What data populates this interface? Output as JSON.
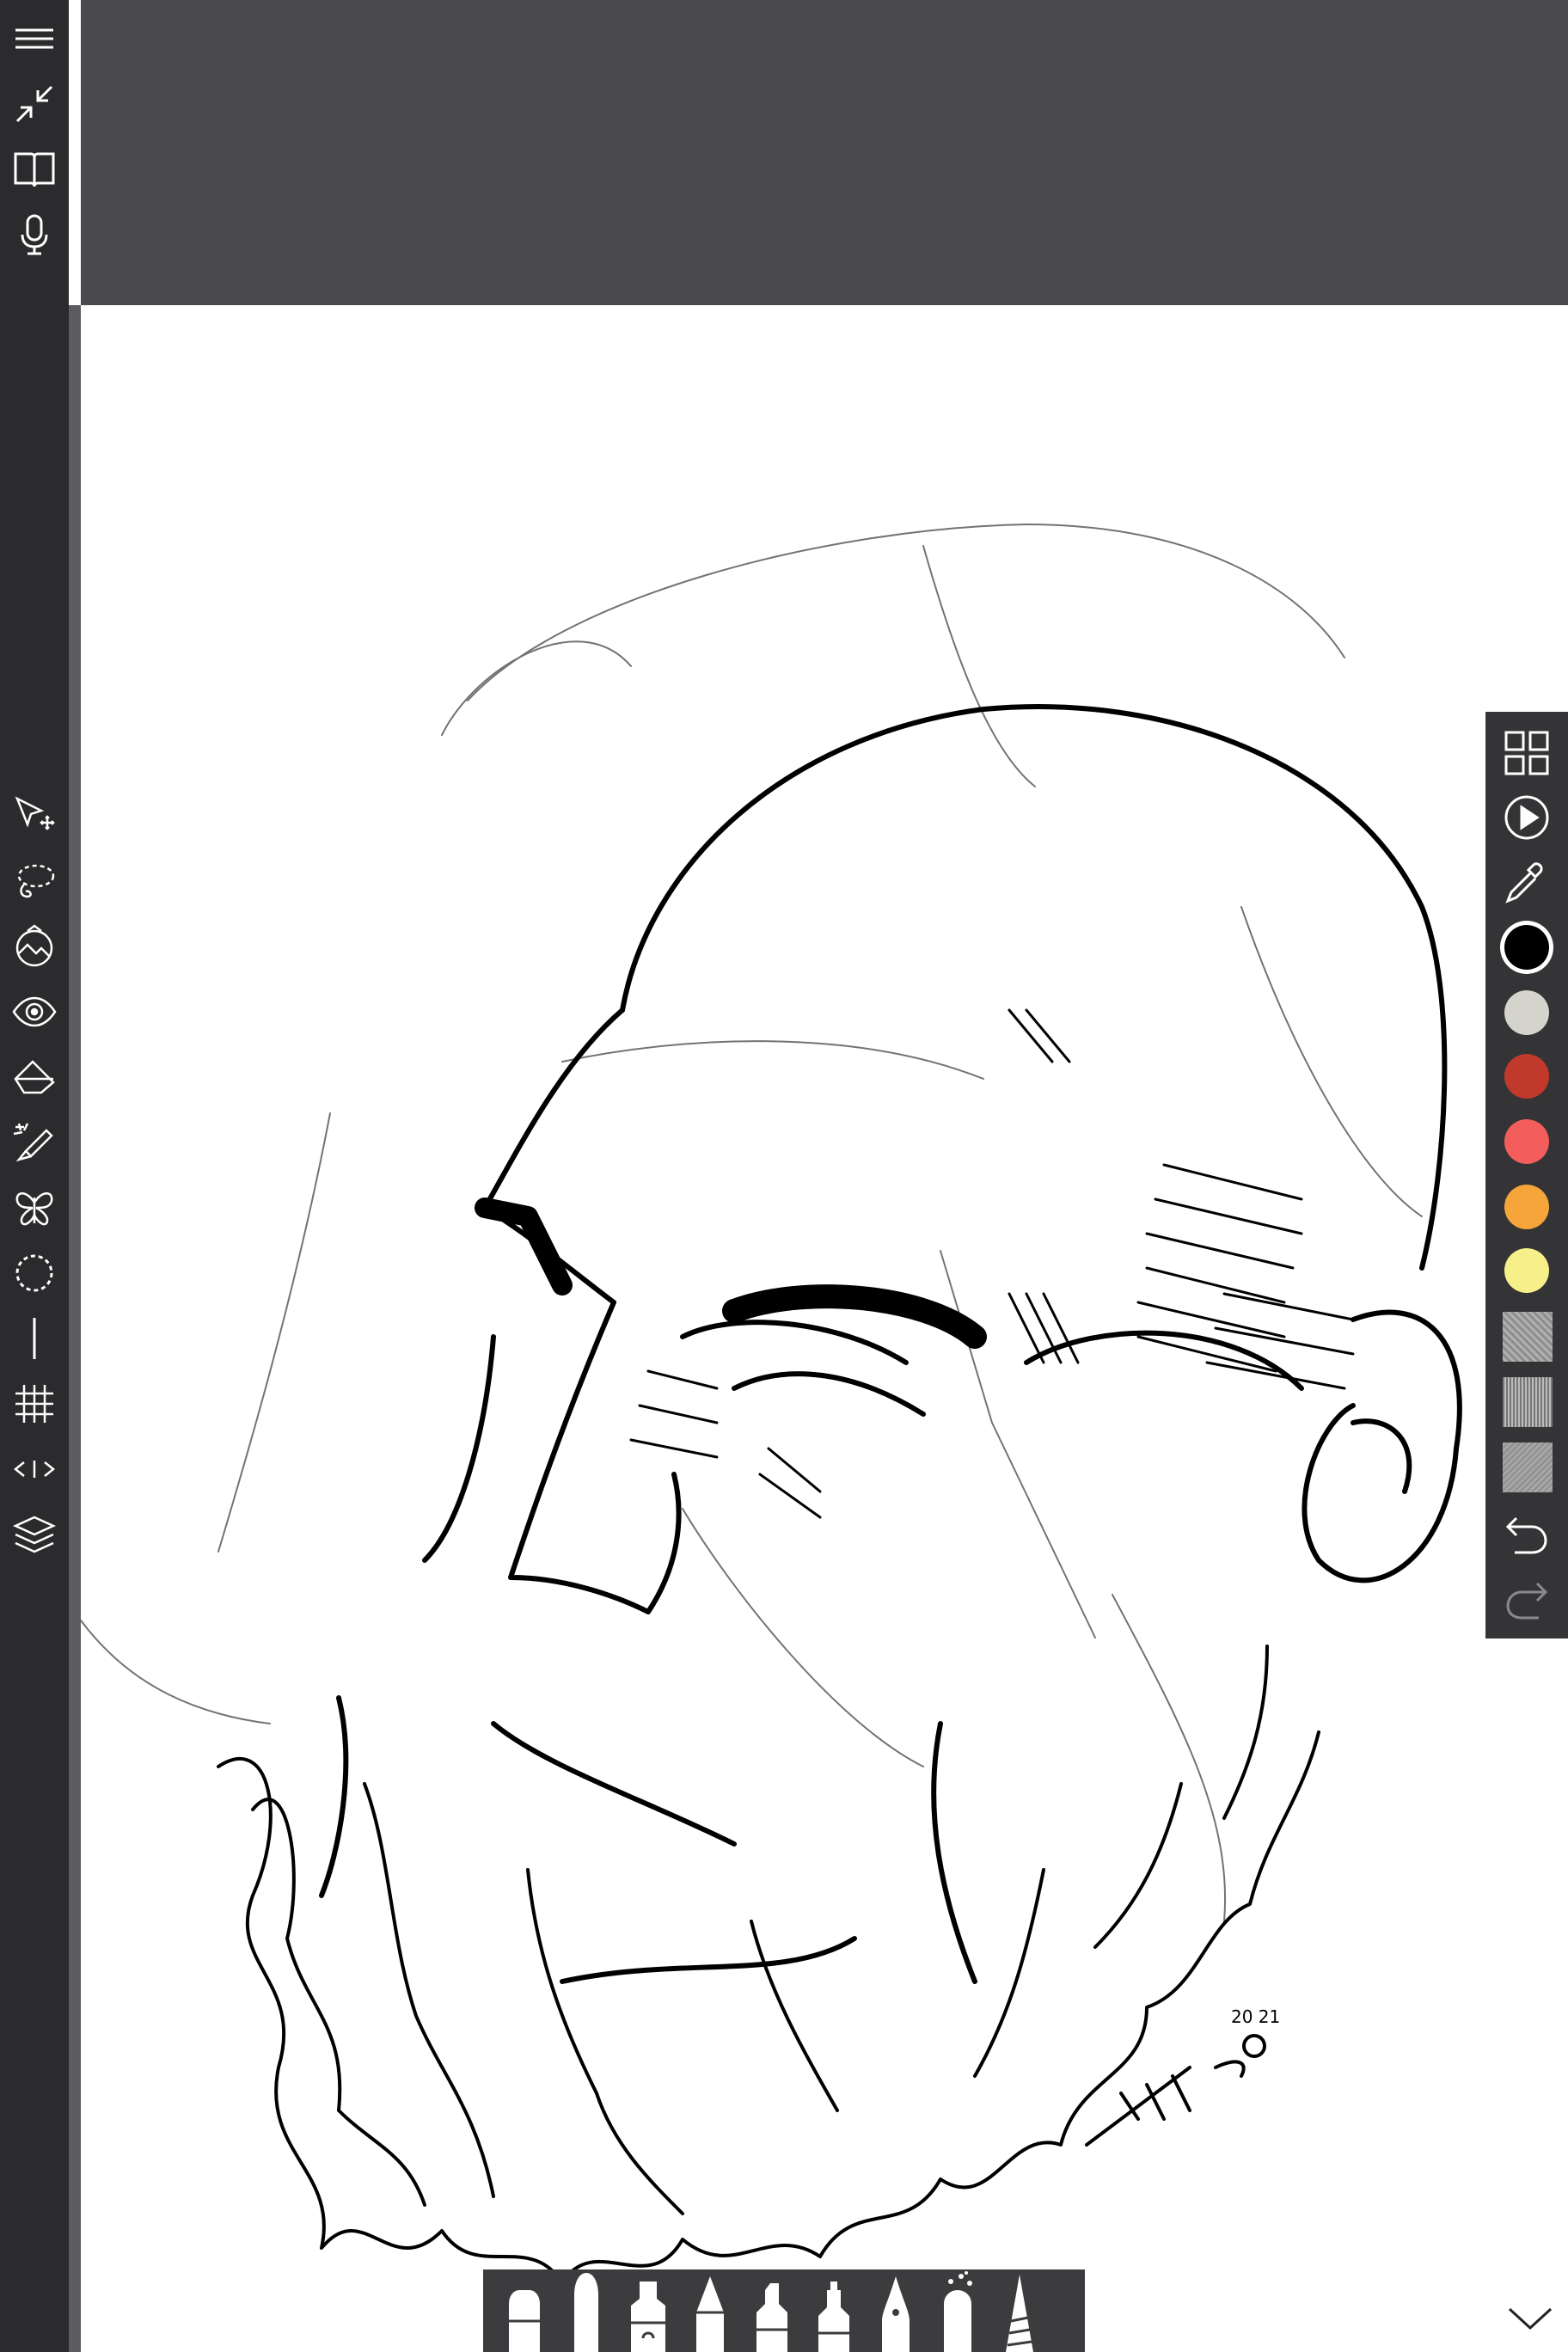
{
  "app": {
    "colors": {
      "toolbar_bg": "#2b2b2d",
      "top_area_bg": "#4a4a4c",
      "canvas_bg": "#ffffff",
      "palette_bg": "#343436",
      "icon_color": "#ffffff"
    }
  },
  "left_toolbar": {
    "top_tools": [
      "menu-icon",
      "minimize-icon",
      "book-icon",
      "microphone-icon"
    ],
    "drawing_tools": [
      "transform-select-icon",
      "lasso-icon",
      "image-adjust-icon",
      "visibility-eye-icon",
      "fill-bucket-icon",
      "magic-brush-icon",
      "symmetry-butterfly-icon",
      "circle-guide-icon",
      "line-guide-icon",
      "grid-guide-icon",
      "perspective-guide-icon",
      "layers-icon"
    ]
  },
  "right_palette": {
    "tools": [
      "grid-view-icon",
      "play-icon",
      "eyedropper-icon"
    ],
    "swatches": [
      {
        "color": "#000000",
        "selected": true
      },
      {
        "color": "#d4d4cc",
        "selected": false
      },
      {
        "color": "#c0392b",
        "selected": false
      },
      {
        "color": "#f35d5b",
        "selected": false
      },
      {
        "color": "#f6a53a",
        "selected": false
      },
      {
        "color": "#f7f08a",
        "selected": false
      }
    ],
    "textures": [
      "noise-texture",
      "crosshatch-texture",
      "grain-texture"
    ],
    "history": [
      "undo-icon",
      "redo-icon"
    ]
  },
  "brush_tray": {
    "brushes": [
      "marker-brush",
      "flat-brush",
      "paint-tube-brush",
      "pencil-brush",
      "felt-pen-brush",
      "marker-cap-brush",
      "fountain-pen-brush",
      "spray-brush",
      "ink-nib-brush"
    ]
  },
  "canvas": {
    "signature_text": "20 21"
  }
}
